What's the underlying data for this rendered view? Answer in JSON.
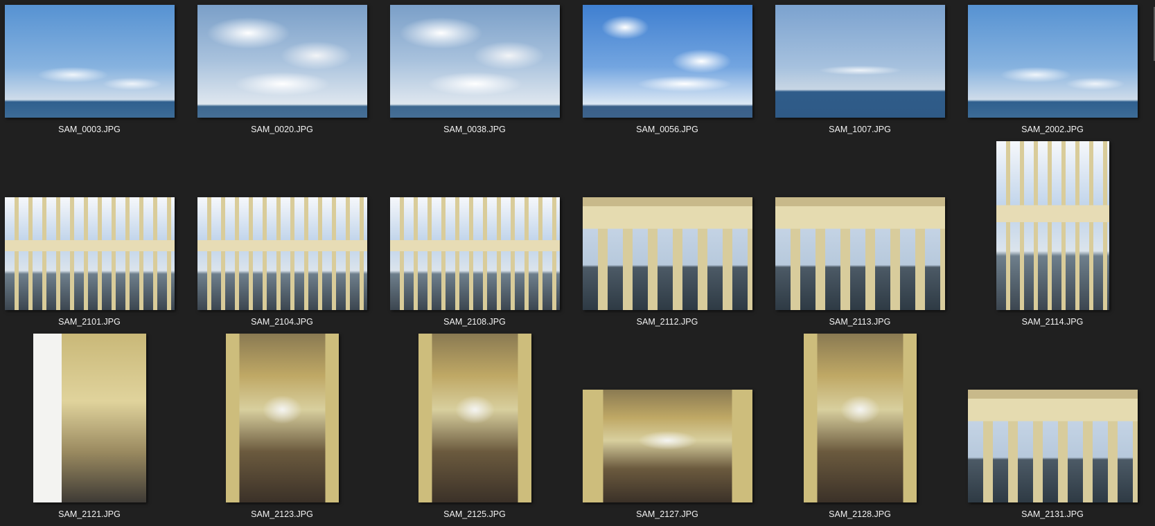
{
  "files": [
    {
      "name": "SAM_0003.JPG"
    },
    {
      "name": "SAM_0020.JPG"
    },
    {
      "name": "SAM_0038.JPG"
    },
    {
      "name": "SAM_0056.JPG"
    },
    {
      "name": "SAM_1007.JPG"
    },
    {
      "name": "SAM_2002.JPG"
    },
    {
      "name": "SAM_2101.JPG"
    },
    {
      "name": "SAM_2104.JPG"
    },
    {
      "name": "SAM_2108.JPG"
    },
    {
      "name": "SAM_2112.JPG"
    },
    {
      "name": "SAM_2113.JPG"
    },
    {
      "name": "SAM_2114.JPG"
    },
    {
      "name": "SAM_2121.JPG"
    },
    {
      "name": "SAM_2123.JPG"
    },
    {
      "name": "SAM_2125.JPG"
    },
    {
      "name": "SAM_2127.JPG"
    },
    {
      "name": "SAM_2128.JPG"
    },
    {
      "name": "SAM_2131.JPG"
    }
  ]
}
